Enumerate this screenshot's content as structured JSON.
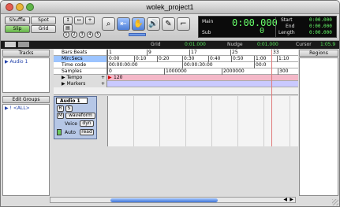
{
  "window": {
    "title": "wolek_project1"
  },
  "edit_modes": {
    "shuffle": "Shuffle",
    "spot": "Spot",
    "slip": "Slip",
    "grid": "Grid"
  },
  "zoom_presets": [
    "1",
    "2",
    "3",
    "4",
    "5"
  ],
  "tools": [
    "zoom-icon",
    "trim-icon",
    "grabber-icon",
    "scrubber-icon",
    "pencil-icon"
  ],
  "counter": {
    "main_label": "Main",
    "main_value": "0:00.000",
    "sub_label": "Sub",
    "sub_value": "0",
    "start_label": "Start",
    "start_value": "0:00.000",
    "end_label": "End",
    "end_value": "0:00.000",
    "length_label": "Length",
    "length_value": "0:00.000"
  },
  "grid_bar": {
    "grid_label": "Grid",
    "grid_value": "0:01.000",
    "nudge_label": "Nudge",
    "nudge_value": "0:01.000",
    "cursor_label": "Cursor",
    "cursor_value": "1:05.9"
  },
  "tracks_panel": {
    "header": "Tracks",
    "items": [
      "Audio 1"
    ]
  },
  "edit_groups": {
    "header": "Edit Groups",
    "items": [
      "! <ALL>"
    ]
  },
  "regions_panel": {
    "header": "Regions"
  },
  "rulers": [
    {
      "label": "Bars:Beats",
      "ticks": [
        "1",
        "9",
        "17",
        "25",
        "33"
      ]
    },
    {
      "label": "Min:Secs",
      "ticks": [
        "0:00",
        "0:10",
        "0:20",
        "0:30",
        "0:40",
        "0:50",
        "1:00",
        "1:10"
      ]
    },
    {
      "label": "Time code",
      "ticks": [
        "00:00:00:00",
        "00:00:30:00",
        "00:0"
      ]
    },
    {
      "label": "Samples",
      "ticks": [
        "0",
        "1000000",
        "2000000",
        "300"
      ]
    },
    {
      "label": "Tempo",
      "ticks": [
        "120"
      ]
    },
    {
      "label": "Markers",
      "ticks": []
    }
  ],
  "track": {
    "name": "Audio 1",
    "rec_button": "R",
    "solo_button": "S",
    "mute_button": "M",
    "view": "waveform",
    "voice_label": "Voice",
    "voice_value": "dyn",
    "auto_label": "Auto",
    "auto_value": "read"
  },
  "colors": {
    "counter_green": "#67ff6a",
    "selection_blue": "#9cc4ff",
    "tempo_pink": "#f4b8c8",
    "markers_lilac": "#c9c9ff"
  }
}
